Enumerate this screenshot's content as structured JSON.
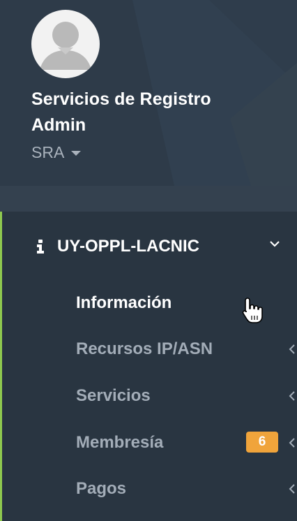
{
  "profile": {
    "name": "Servicios de Registro Admin",
    "role": "SRA",
    "role_icon": "caret-down-icon",
    "avatar_icon": "user-avatar-placeholder"
  },
  "menu": {
    "group": {
      "label": "UY-OPPL-LACNIC",
      "icon": "info-icon",
      "toggle_icon": "chevron-down-icon",
      "expanded": true
    },
    "items": [
      {
        "label": "Información",
        "active": true
      },
      {
        "label": "Recursos IP/ASN",
        "icon": "chevron-left-icon"
      },
      {
        "label": "Servicios",
        "icon": "chevron-left-icon"
      },
      {
        "label": "Membresía",
        "badge": "6",
        "icon": "chevron-left-icon"
      },
      {
        "label": "Pagos",
        "icon": "chevron-left-icon"
      }
    ]
  },
  "colors": {
    "sidebar_bg": "#293541",
    "profile_bg": "#2e3b49",
    "active_indicator": "#8ec94f",
    "badge_bg": "#f0a43b",
    "text_active": "#ffffff",
    "text_inactive": "#a3adb8"
  },
  "cursor": "hand-pointer-icon"
}
